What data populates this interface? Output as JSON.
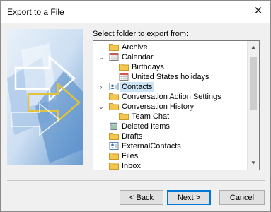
{
  "window": {
    "title": "Export to a File",
    "close_glyph": "✕"
  },
  "prompt": "Select folder to export from:",
  "tree": {
    "items": [
      {
        "label": "Archive",
        "icon": "folder-icon",
        "depth": 1,
        "expander": ""
      },
      {
        "label": "Calendar",
        "icon": "calendar-icon",
        "depth": 1,
        "expander": "v"
      },
      {
        "label": "Birthdays",
        "icon": "folder-icon",
        "depth": 2,
        "expander": ""
      },
      {
        "label": "United States holidays",
        "icon": "calendar-icon",
        "depth": 2,
        "expander": ""
      },
      {
        "label": "Contacts",
        "icon": "contacts-icon",
        "depth": 1,
        "expander": ">",
        "selected": true
      },
      {
        "label": "Conversation Action Settings",
        "icon": "folder-icon",
        "depth": 1,
        "expander": ""
      },
      {
        "label": "Conversation History",
        "icon": "folder-icon",
        "depth": 1,
        "expander": "v"
      },
      {
        "label": "Team Chat",
        "icon": "folder-icon",
        "depth": 2,
        "expander": ""
      },
      {
        "label": "Deleted Items",
        "icon": "trash-icon",
        "depth": 1,
        "expander": ""
      },
      {
        "label": "Drafts",
        "icon": "folder-icon",
        "depth": 1,
        "expander": ""
      },
      {
        "label": "ExternalContacts",
        "icon": "contacts-icon",
        "depth": 1,
        "expander": ""
      },
      {
        "label": "Files",
        "icon": "folder-icon",
        "depth": 1,
        "expander": ""
      },
      {
        "label": "Inbox",
        "icon": "folder-icon",
        "depth": 1,
        "expander": ""
      }
    ]
  },
  "buttons": {
    "back": "< Back",
    "next": "Next >",
    "cancel": "Cancel"
  },
  "colors": {
    "selection": "#cce4f7",
    "accent": "#0078d7",
    "folder": "#f3c64f"
  }
}
